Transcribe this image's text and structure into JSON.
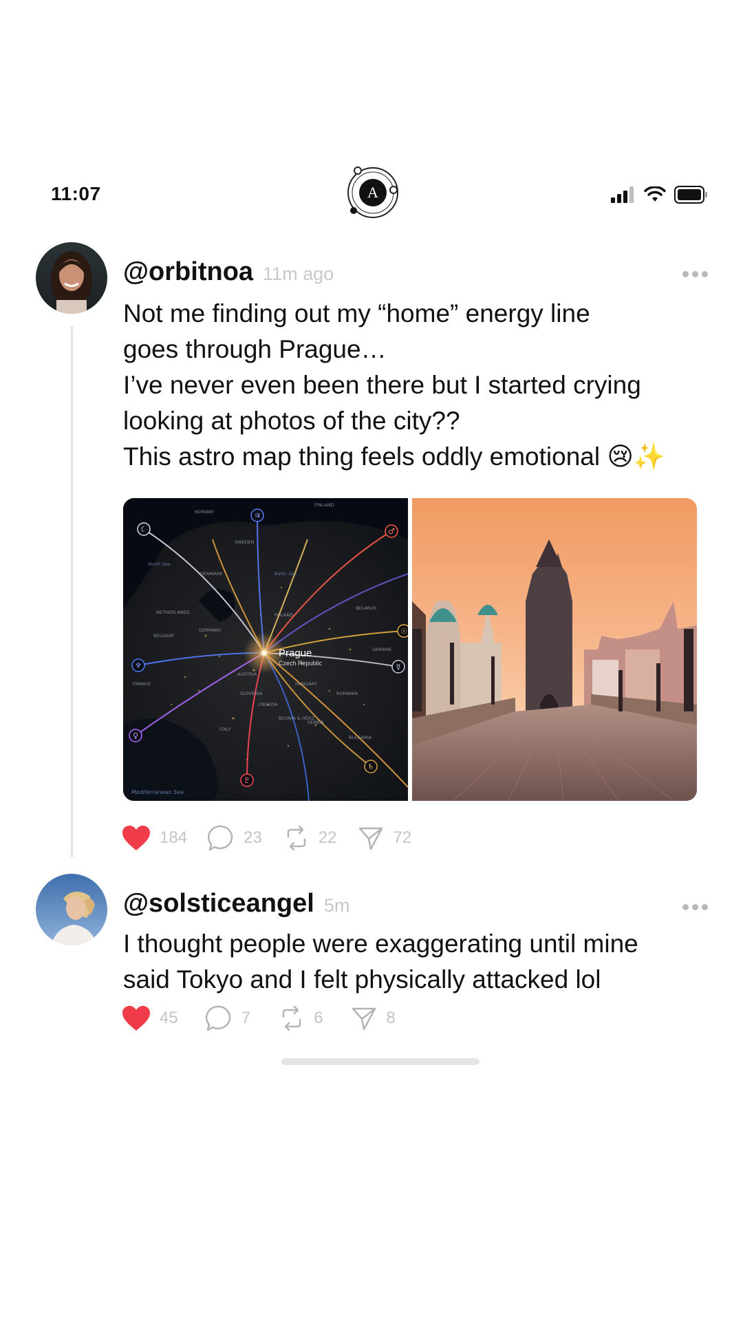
{
  "status_bar": {
    "time": "11:07",
    "logo_letter": "A"
  },
  "posts": [
    {
      "handle": "@orbitnoa",
      "time_ago": "11m ago",
      "text_lines": [
        "Not me finding out my “home” energy line",
        "goes through Prague…",
        "I’ve never even been there but I started crying",
        "looking at photos of the city??",
        "This astro map thing feels oddly emotional 😢✨"
      ],
      "media": {
        "map": {
          "city": "Prague",
          "country": "Czech Republic",
          "labels": [
            "NORWAY",
            "FINLAND",
            "SWEDEN",
            "North Sea",
            "DENMARK",
            "Baltic Sea",
            "NETHERLANDS",
            "POLAND",
            "BELARUS",
            "BELGIUM",
            "GERMANY",
            "UKRAINE",
            "FRANCE",
            "AUSTRIA",
            "HUNGARY",
            "ROMANIA",
            "SLOVENIA",
            "CROATIA",
            "BOSNIA & HERZ.",
            "SERBIA",
            "ITALY",
            "BULGARIA",
            "Mediterranean Sea"
          ]
        }
      },
      "actions": {
        "likes": "184",
        "comments": "23",
        "reposts": "22",
        "shares": "72"
      }
    },
    {
      "handle": "@solsticeangel",
      "time_ago": "5m",
      "text_lines": [
        "I thought people were exaggerating until mine",
        "said Tokyo and I felt physically attacked lol"
      ],
      "actions": {
        "likes": "45",
        "comments": "7",
        "reposts": "6",
        "shares": "8"
      }
    }
  ],
  "colors": {
    "heart": "#ef3b4a",
    "muted": "#c4c4c4",
    "thread_line": "#e3e3e3"
  }
}
